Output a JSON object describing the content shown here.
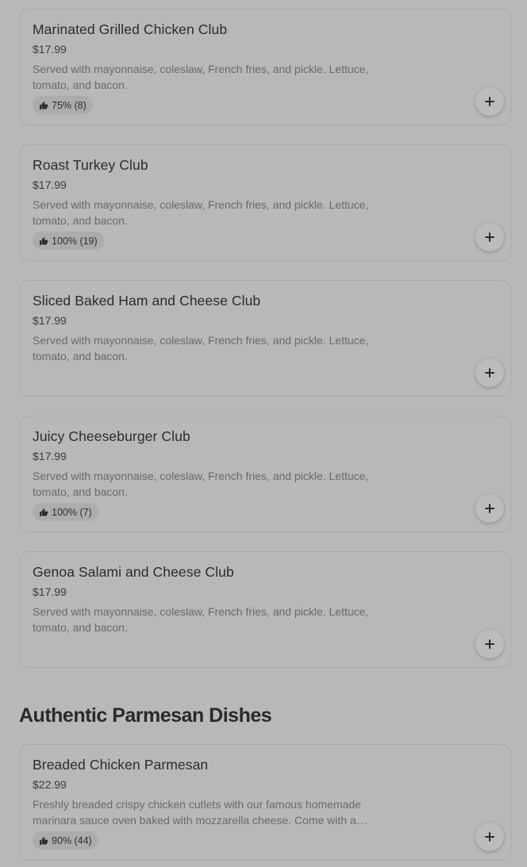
{
  "items": [
    {
      "name": "Marinated Grilled Chicken Club",
      "price": "$17.99",
      "description": "Served with mayonnaise, coleslaw, French fries, and pickle. Lettuce, tomato, and bacon.",
      "rating": "75% (8)"
    },
    {
      "name": "Roast Turkey Club",
      "price": "$17.99",
      "description": "Served with mayonnaise, coleslaw, French fries, and pickle. Lettuce, tomato, and bacon.",
      "rating": "100% (19)"
    },
    {
      "name": "Sliced Baked Ham and Cheese Club",
      "price": "$17.99",
      "description": "Served with mayonnaise, coleslaw, French fries, and pickle. Lettuce, tomato, and bacon."
    },
    {
      "name": "Juicy Cheeseburger Club",
      "price": "$17.99",
      "description": "Served with mayonnaise, coleslaw, French fries, and pickle. Lettuce, tomato, and bacon.",
      "rating": "100% (7)"
    },
    {
      "name": "Genoa Salami and Cheese Club",
      "price": "$17.99",
      "description": "Served with mayonnaise, coleslaw, French fries, and pickle. Lettuce, tomato, and bacon."
    }
  ],
  "section": {
    "title": "Authentic Parmesan Dishes",
    "items": [
      {
        "name": "Breaded Chicken Parmesan",
        "price": "$22.99",
        "description": "Freshly breaded crispy chicken cutlets with our famous homemade marinara sauce oven baked with mozzarella cheese. Come with a…",
        "rating": "90% (44)"
      }
    ]
  },
  "icons": {
    "add": "plus-icon",
    "rating": "thumbs-up-icon"
  }
}
